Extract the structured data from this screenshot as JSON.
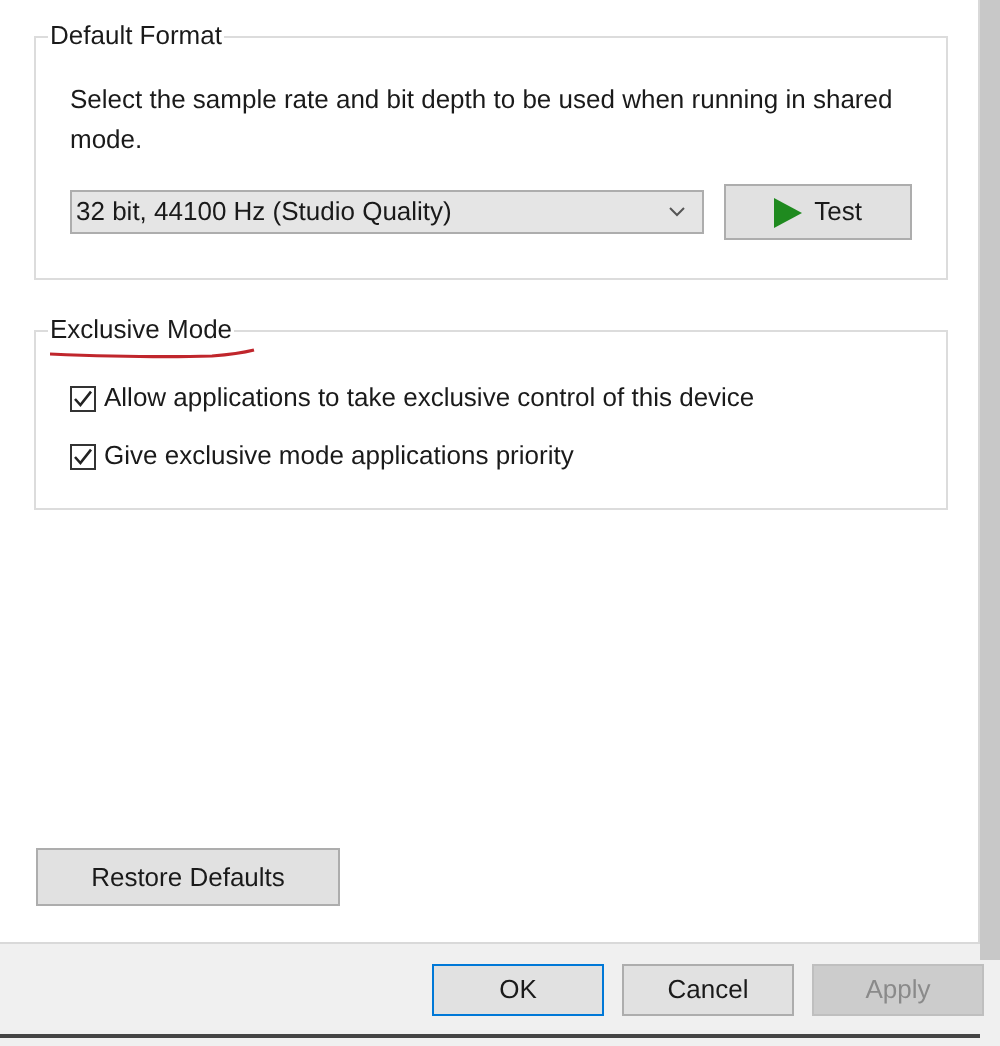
{
  "default_format": {
    "title": "Default Format",
    "description": "Select the sample rate and bit depth to be used when running in shared mode.",
    "format_dropdown": {
      "value": "32 bit, 44100 Hz (Studio Quality)"
    },
    "test_button": {
      "label": "Test"
    }
  },
  "exclusive_mode": {
    "title": "Exclusive Mode",
    "options": [
      {
        "label": "Allow applications to take exclusive control of this device",
        "checked": true
      },
      {
        "label": "Give exclusive mode applications priority",
        "checked": true
      }
    ]
  },
  "restore_button": {
    "label": "Restore Defaults"
  },
  "buttons": [
    {
      "label": "OK",
      "default": true,
      "disabled": false
    },
    {
      "label": "Cancel",
      "default": false,
      "disabled": false
    },
    {
      "label": "Apply",
      "default": false,
      "disabled": true
    }
  ]
}
